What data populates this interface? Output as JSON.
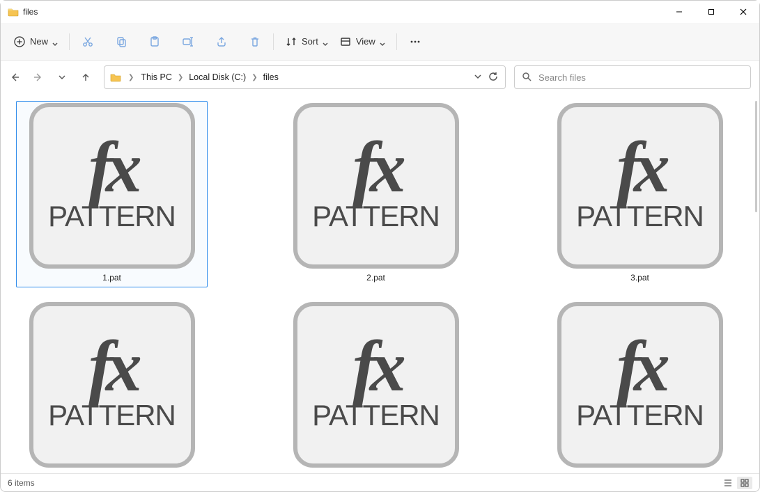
{
  "window": {
    "title": "files"
  },
  "toolbar": {
    "new_label": "New",
    "sort_label": "Sort",
    "view_label": "View"
  },
  "breadcrumbs": [
    "This PC",
    "Local Disk (C:)",
    "files"
  ],
  "search": {
    "placeholder": "Search files"
  },
  "thumb": {
    "fx": "fx",
    "pattern": "PATTERN"
  },
  "files": [
    {
      "name": "1.pat",
      "selected": true
    },
    {
      "name": "2.pat",
      "selected": false
    },
    {
      "name": "3.pat",
      "selected": false
    },
    {
      "name": "",
      "selected": false
    },
    {
      "name": "",
      "selected": false
    },
    {
      "name": "",
      "selected": false
    }
  ],
  "status": {
    "count_text": "6 items"
  }
}
